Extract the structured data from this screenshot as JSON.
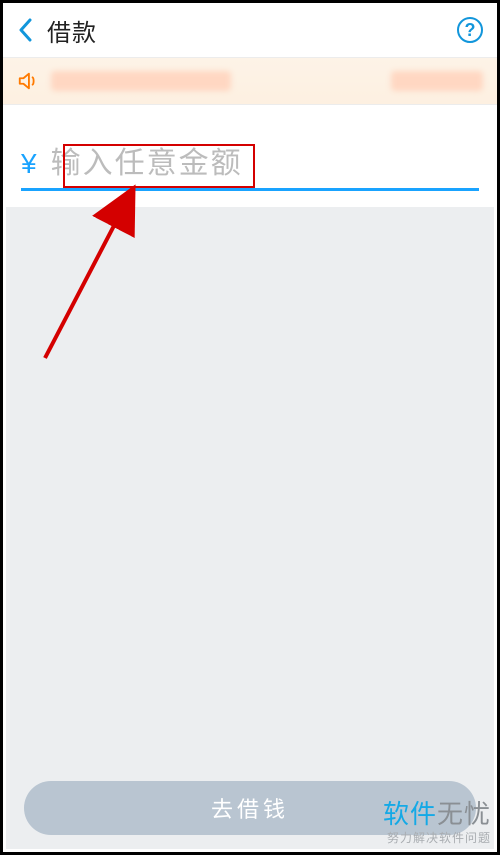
{
  "header": {
    "title": "借款",
    "help_symbol": "?"
  },
  "amount": {
    "currency_symbol": "¥",
    "placeholder": "输入任意金额",
    "value": ""
  },
  "action": {
    "borrow_label": "去借钱"
  },
  "watermark": {
    "brand_a": "软件",
    "brand_b": "无忧",
    "tagline": "努力解决软件问题"
  },
  "icons": {
    "back": "back-chevron",
    "help": "help-circle",
    "speaker": "announcement-speaker"
  }
}
